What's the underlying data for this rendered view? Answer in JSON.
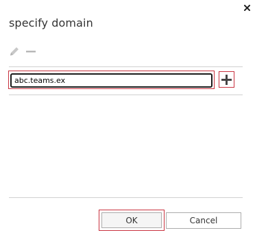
{
  "dialog": {
    "title": "specify domain",
    "close_icon": "close-icon"
  },
  "toolbar": {
    "edit_icon": "pencil-icon",
    "remove_icon": "minus-icon"
  },
  "domain_field": {
    "value": "abc.teams.ex"
  },
  "add_button": {
    "icon": "plus-icon"
  },
  "footer": {
    "ok_label": "OK",
    "cancel_label": "Cancel"
  },
  "colors": {
    "highlight": "#c8313e",
    "divider": "#d0d0d0",
    "text": "#333333"
  }
}
